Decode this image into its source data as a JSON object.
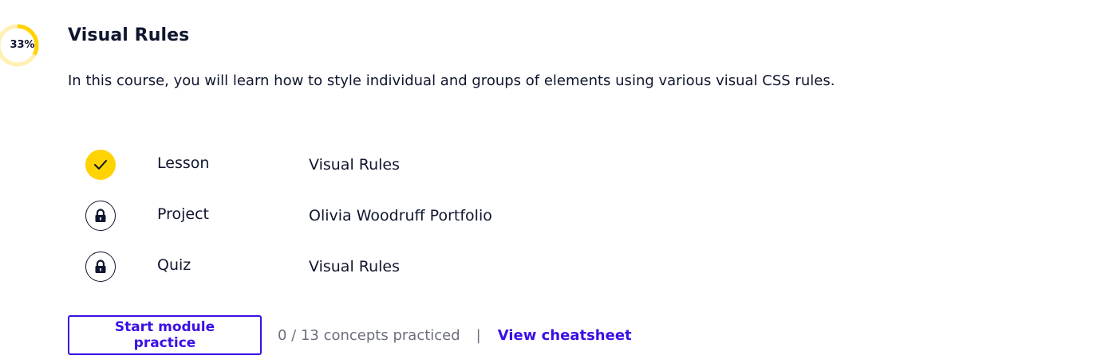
{
  "module": {
    "progress_label": "33%",
    "progress_value": 0.33,
    "title": "Visual Rules",
    "description": "In this course, you will learn how to style individual and groups of elements using various visual CSS rules."
  },
  "items": [
    {
      "type": "Lesson",
      "name": "Visual Rules",
      "status": "complete",
      "icon": "checkmark-icon"
    },
    {
      "type": "Project",
      "name": "Olivia Woodruff Portfolio",
      "status": "locked",
      "icon": "lock-icon"
    },
    {
      "type": "Quiz",
      "name": "Visual Rules",
      "status": "locked",
      "icon": "lock-icon"
    }
  ],
  "footer": {
    "practice_button": "Start module practice",
    "concepts_practiced": "0 / 13 concepts practiced",
    "separator": "|",
    "cheatsheet_link": "View cheatsheet"
  },
  "colors": {
    "accent": "#3a10e5",
    "complete": "#ffd300",
    "progress_track": "#fff0b3",
    "text": "#10162f",
    "muted": "#6b6f7f"
  }
}
